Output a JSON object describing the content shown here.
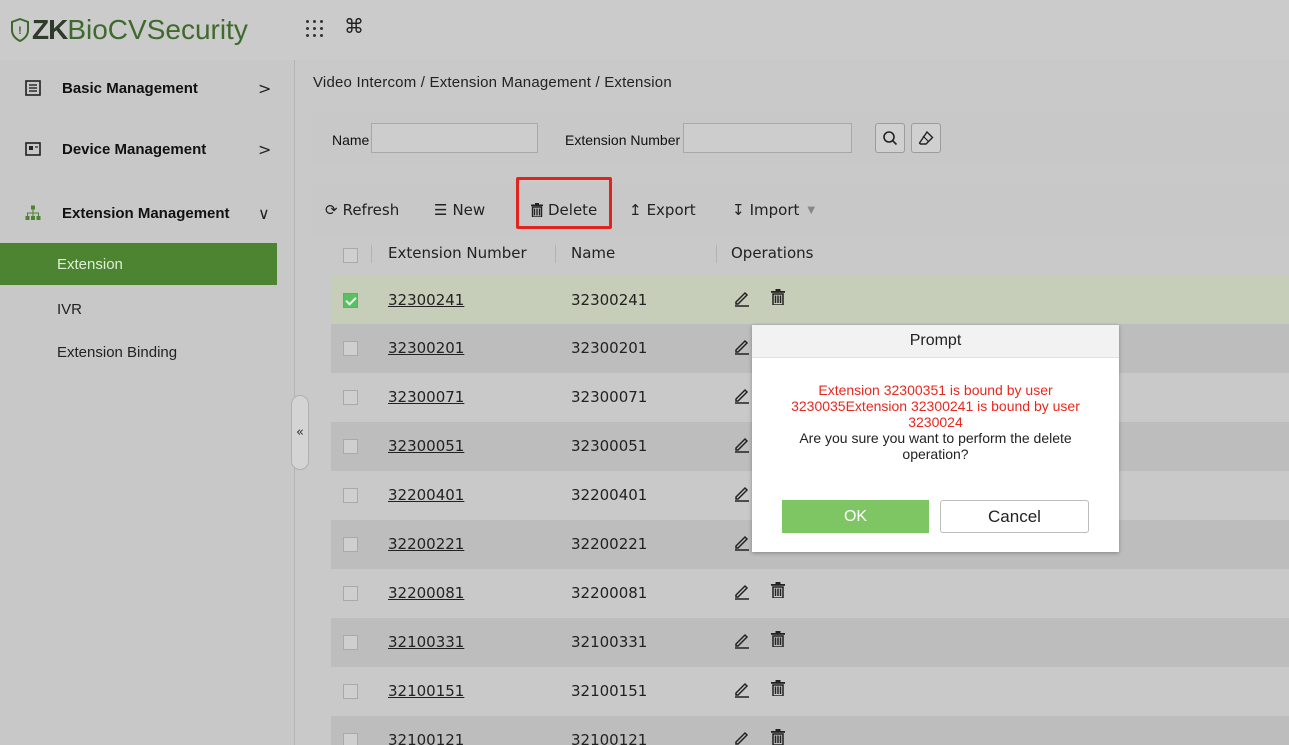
{
  "app": {
    "logo_prefix": "ZK",
    "logo_bio": "Bio",
    "logo_rest": " CVSecurity"
  },
  "topbar": {
    "apps_icon": "grid-icon",
    "cmd_icon": "command-icon"
  },
  "sidebar": {
    "groups": [
      {
        "label": "Basic Management",
        "arrow": ">"
      },
      {
        "label": "Device Management",
        "arrow": ">"
      },
      {
        "label": "Extension Management",
        "arrow": "∨"
      }
    ],
    "sub_items": [
      {
        "label": "Extension",
        "active": true
      },
      {
        "label": "IVR"
      },
      {
        "label": "Extension Binding"
      }
    ],
    "collapse": "«"
  },
  "breadcrumb": "Video Intercom / Extension Management / Extension",
  "filter": {
    "name_label": "Name",
    "ext_label": "Extension Number"
  },
  "toolbar": {
    "refresh": "Refresh",
    "new": "New",
    "delete": "Delete",
    "export": "Export",
    "import": "Import"
  },
  "table": {
    "headers": [
      "Extension Number",
      "Name",
      "Operations"
    ],
    "rows": [
      {
        "ext": "32300241",
        "name": "32300241",
        "checked": true
      },
      {
        "ext": "32300201",
        "name": "32300201",
        "checked": false
      },
      {
        "ext": "32300071",
        "name": "32300071",
        "checked": false
      },
      {
        "ext": "32300051",
        "name": "32300051",
        "checked": false
      },
      {
        "ext": "32200401",
        "name": "32200401",
        "checked": false
      },
      {
        "ext": "32200221",
        "name": "32200221",
        "checked": false
      },
      {
        "ext": "32200081",
        "name": "32200081",
        "checked": false
      },
      {
        "ext": "32100331",
        "name": "32100331",
        "checked": false
      },
      {
        "ext": "32100151",
        "name": "32100151",
        "checked": false
      },
      {
        "ext": "32100121",
        "name": "32100121",
        "checked": false
      }
    ]
  },
  "dialog": {
    "title": "Prompt",
    "error_line1": "Extension 32300351 is bound by user",
    "error_line2": "3230035Extension 32300241 is bound by user",
    "error_line3": "3230024",
    "confirm_line1": "Are you sure you want to perform the delete",
    "confirm_line2": "operation?",
    "ok": "OK",
    "cancel": "Cancel"
  },
  "colors": {
    "accent": "#4c8431",
    "danger": "#e8281f",
    "ok_button": "#7ec563"
  }
}
